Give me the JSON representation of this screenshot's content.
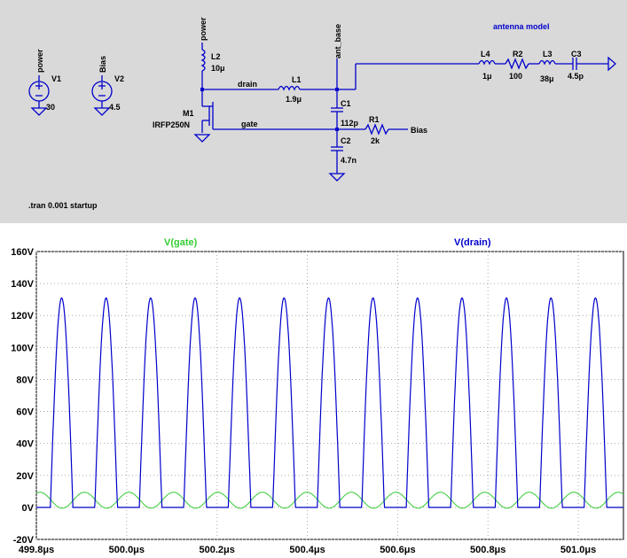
{
  "schematic": {
    "sources": [
      {
        "ref": "V1",
        "value": "30",
        "net": "power"
      },
      {
        "ref": "V2",
        "value": "4.5",
        "net": "Bias"
      }
    ],
    "L2": {
      "ref": "L2",
      "value": "10μ",
      "net": "power"
    },
    "M1": {
      "ref": "M1",
      "model": "IRFP250N"
    },
    "nets": {
      "drain": "drain",
      "gate": "gate",
      "ant_base": "ant_base",
      "bias": "Bias"
    },
    "L1": {
      "ref": "L1",
      "value": "1.9μ"
    },
    "C1": {
      "ref": "C1",
      "value": "112p"
    },
    "C2": {
      "ref": "C2",
      "value": "4.7n"
    },
    "R1": {
      "ref": "R1",
      "value": "2k"
    },
    "antenna_label": "antenna model",
    "L4": {
      "ref": "L4",
      "value": "1μ"
    },
    "R2": {
      "ref": "R2",
      "value": "100"
    },
    "L3": {
      "ref": "L3",
      "value": "38μ"
    },
    "C3": {
      "ref": "C3",
      "value": "4.5p"
    },
    "directive": ".tran 0.001 startup"
  },
  "colors": {
    "schematic_bg": "#d9d9d9",
    "wire": "#0000cc",
    "gate_trace": "#33cc33",
    "drain_trace": "#0000cc",
    "plot_bg": "#ffffff",
    "grid": "#aaaaaa"
  },
  "chart_data": {
    "type": "line",
    "x_unit": "μs",
    "y_unit": "V",
    "x_ticks": [
      "499.8μs",
      "500.0μs",
      "500.2μs",
      "500.4μs",
      "500.6μs",
      "500.8μs",
      "501.0μs"
    ],
    "y_ticks": [
      "160V",
      "140V",
      "120V",
      "100V",
      "80V",
      "60V",
      "40V",
      "20V",
      "0V",
      "-20V"
    ],
    "xlim": [
      499.8,
      501.1
    ],
    "ylim": [
      -20,
      160
    ],
    "grid": true,
    "series": [
      {
        "name": "V(gate)",
        "color": "#33cc33",
        "period_us": 0.0985,
        "offset_V": 4.5,
        "amplitude_V": 5,
        "first_peak_us": 499.808
      },
      {
        "name": "V(drain)",
        "color": "#0000cc",
        "period_us": 0.0985,
        "peak_V": 131,
        "min_V": 0,
        "first_peak_us": 499.856,
        "pulse_width_us": 0.05
      }
    ]
  }
}
